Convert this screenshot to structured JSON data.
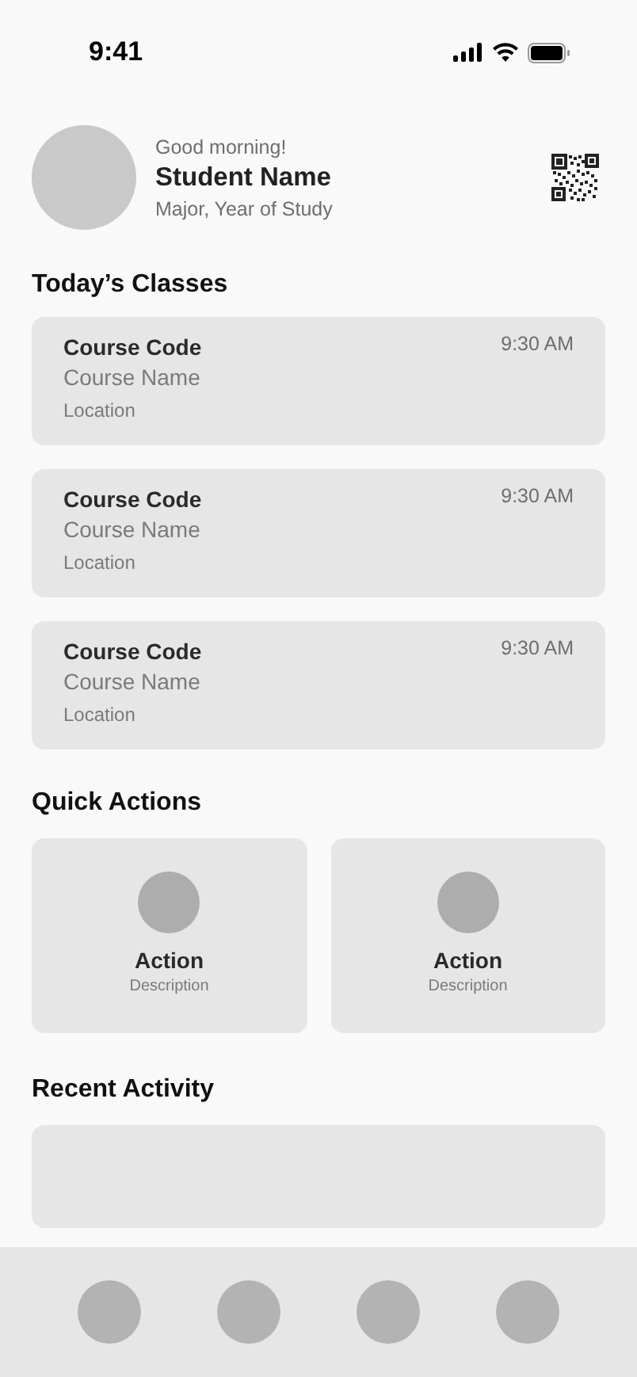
{
  "status_bar": {
    "time": "9:41"
  },
  "profile": {
    "greeting": "Good morning!",
    "name": "Student Name",
    "subtitle": "Major, Year of Study"
  },
  "classes": {
    "title": "Today’s Classes",
    "items": [
      {
        "code": "Course Code",
        "name": "Course Name",
        "location": "Location",
        "time": "9:30 AM"
      },
      {
        "code": "Course Code",
        "name": "Course Name",
        "location": "Location",
        "time": "9:30 AM"
      },
      {
        "code": "Course Code",
        "name": "Course Name",
        "location": "Location",
        "time": "9:30 AM"
      }
    ]
  },
  "quick_actions": {
    "title": "Quick Actions",
    "items": [
      {
        "label": "Action",
        "description": "Description"
      },
      {
        "label": "Action",
        "description": "Description"
      }
    ]
  },
  "recent_activity": {
    "title": "Recent Activity"
  },
  "bottom_nav": {
    "items": [
      {
        "kind": "tab"
      },
      {
        "kind": "tab"
      },
      {
        "kind": "tab"
      },
      {
        "kind": "tab"
      }
    ]
  }
}
